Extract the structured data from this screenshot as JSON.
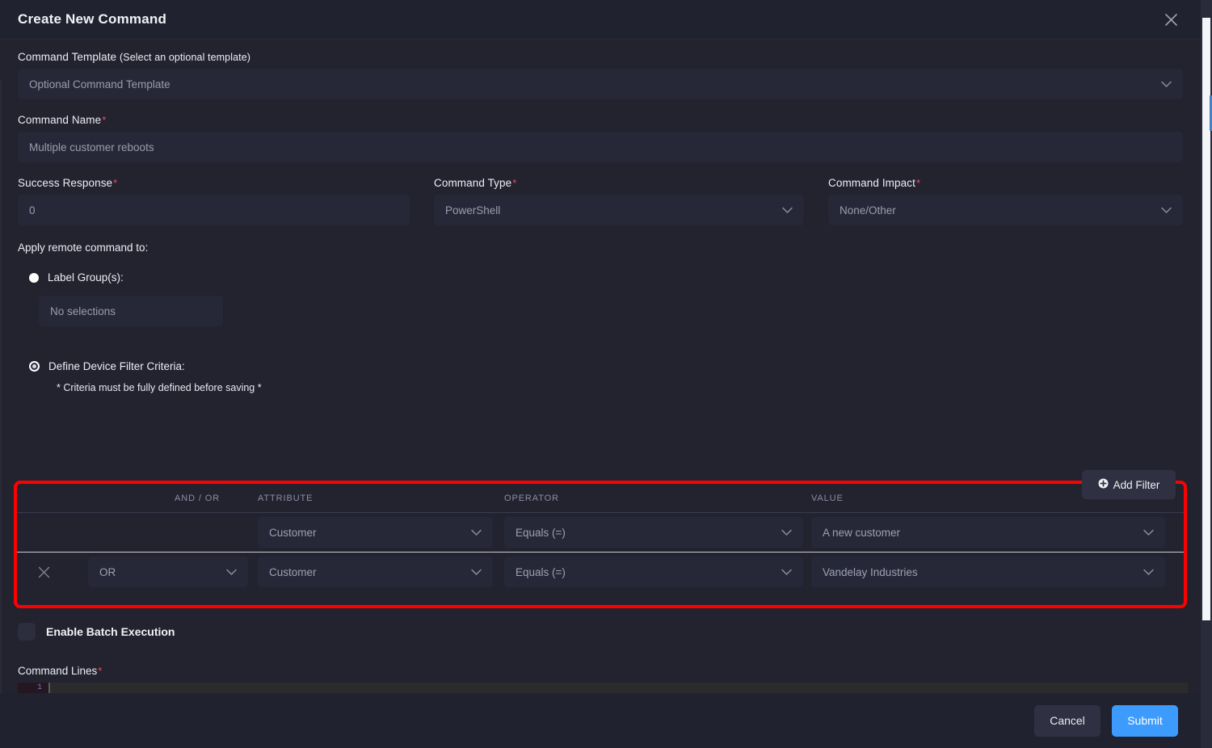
{
  "modal": {
    "title": "Create New Command",
    "close_icon": "close-icon"
  },
  "form": {
    "template": {
      "label": "Command Template ",
      "label_sub": "(Select an optional template)",
      "value": "Optional Command Template",
      "chevron_icon": "chevron-down-icon"
    },
    "command_name": {
      "label": "Command Name",
      "required_mark": "*",
      "value": "Multiple customer reboots"
    },
    "success_response": {
      "label": "Success Response",
      "required_mark": "*",
      "value": "0"
    },
    "command_type": {
      "label": "Command Type",
      "required_mark": "*",
      "value": "PowerShell"
    },
    "command_impact": {
      "label": "Command Impact",
      "required_mark": "*",
      "value": "None/Other"
    }
  },
  "apply_section": {
    "heading": "Apply remote command to:",
    "label_group": {
      "label": "Label Group(s):",
      "selected": false,
      "selection_value": "No selections"
    },
    "device_filter": {
      "label": "Define Device Filter Criteria:",
      "selected": true,
      "note": "* Criteria must be fully defined before saving *"
    }
  },
  "filter_table": {
    "add_filter_label": "Add Filter",
    "add_filter_icon": "plus-circle-icon",
    "highlight_color": "#ff0000",
    "columns": [
      "",
      "AND / OR",
      "ATTRIBUTE",
      "OPERATOR",
      "VALUE"
    ],
    "rows": [
      {
        "delete_icon": "",
        "and_or": "",
        "attribute": "Customer",
        "operator": "Equals (=)",
        "value": "A new customer"
      },
      {
        "delete_icon": "close-icon",
        "and_or": "OR",
        "attribute": "Customer",
        "operator": "Equals (=)",
        "value": "Vandelay Industries"
      }
    ]
  },
  "batch": {
    "label": "Enable Batch Execution",
    "checked": false
  },
  "command_lines": {
    "label": "Command Lines",
    "required_mark": "*",
    "line_number": "1",
    "content": ""
  },
  "footer": {
    "cancel_label": "Cancel",
    "submit_label": "Submit",
    "submit_color": "#3d9bfd"
  }
}
